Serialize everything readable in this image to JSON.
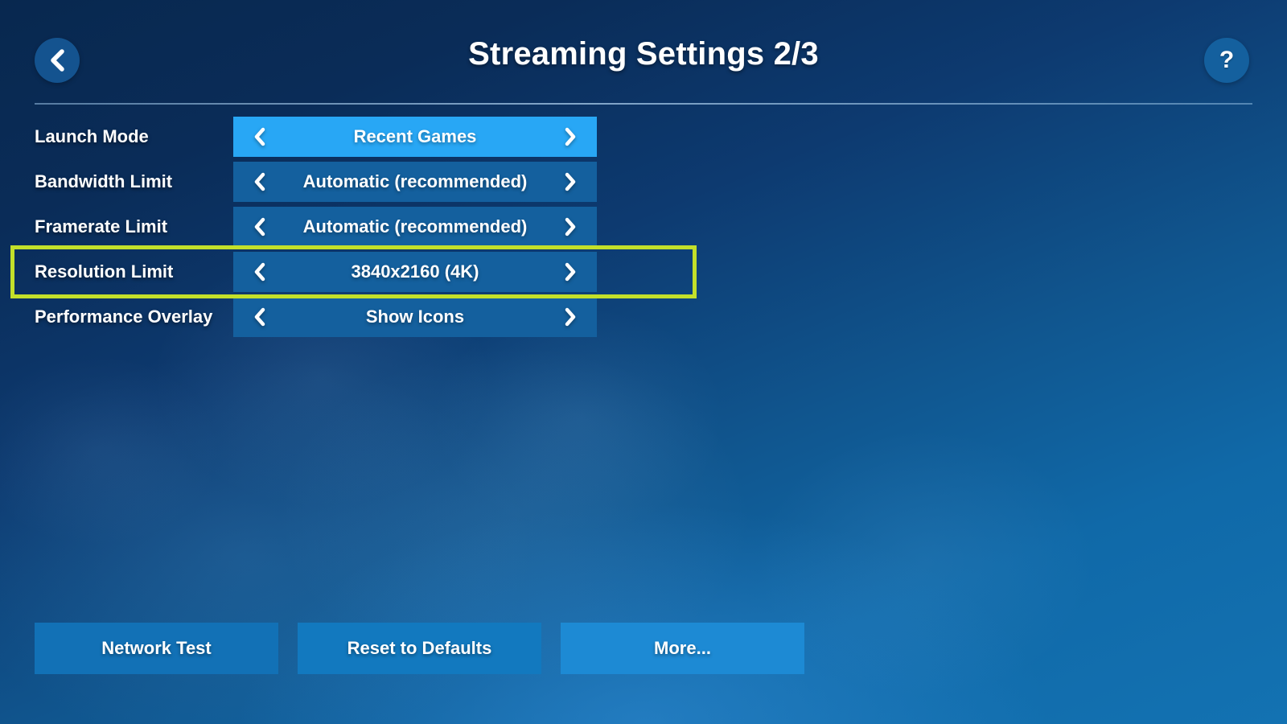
{
  "header": {
    "title": "Streaming Settings 2/3",
    "back_icon": "chevron-left-icon",
    "help_icon": "question-mark-icon",
    "help_label": "?"
  },
  "settings": {
    "prev_icon": "chevron-left-icon",
    "next_icon": "chevron-right-icon",
    "rows": [
      {
        "label": "Launch Mode",
        "value": "Recent Games",
        "selected": true,
        "focused": false
      },
      {
        "label": "Bandwidth Limit",
        "value": "Automatic (recommended)",
        "selected": false,
        "focused": false
      },
      {
        "label": "Framerate Limit",
        "value": "Automatic (recommended)",
        "selected": false,
        "focused": false
      },
      {
        "label": "Resolution Limit",
        "value": "3840x2160 (4K)",
        "selected": false,
        "focused": true
      },
      {
        "label": "Performance Overlay",
        "value": "Show Icons",
        "selected": false,
        "focused": false
      }
    ]
  },
  "bottom_buttons": [
    {
      "label": "Network Test"
    },
    {
      "label": "Reset to Defaults"
    },
    {
      "label": "More..."
    }
  ],
  "colors": {
    "row_default": "#14609e",
    "row_selected": "#28a7f5",
    "focus_outline": "#c3e02a",
    "background_dark": "#08284f",
    "background_light": "#1372b2",
    "text": "#ffffff"
  }
}
